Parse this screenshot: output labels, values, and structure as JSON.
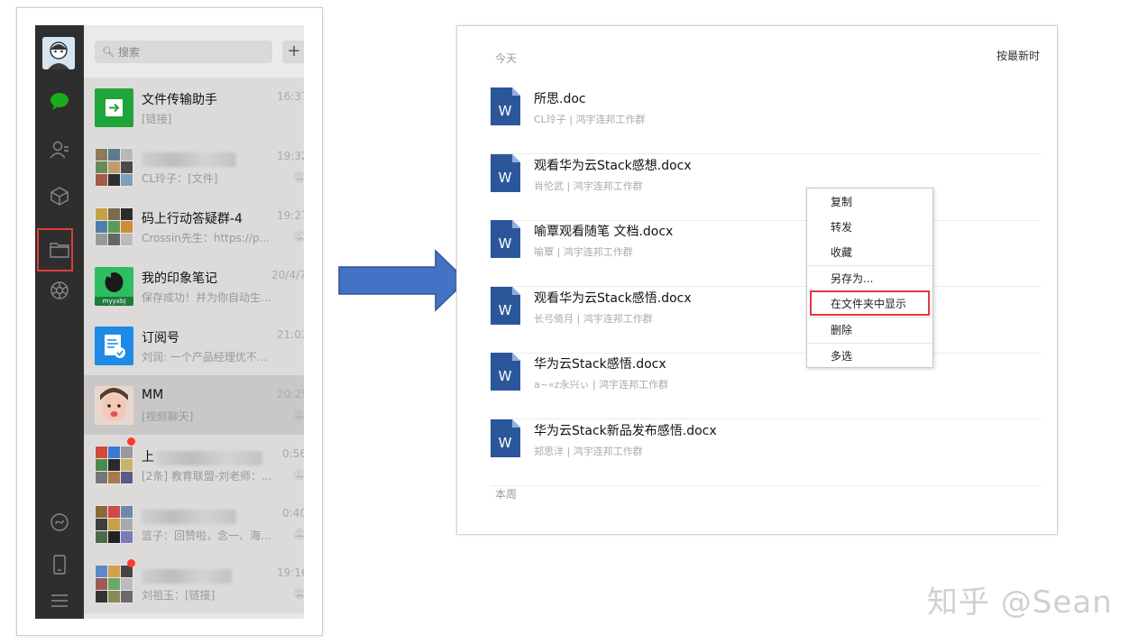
{
  "chat_window": {
    "search": {
      "placeholder": "搜索",
      "add_label": "+"
    },
    "sidebar_icons": [
      "avatar",
      "chat-icon",
      "contacts-icon",
      "favorites-icon",
      "folder-icon",
      "moments-icon",
      "mini-program-icon",
      "phone-icon",
      "menu-icon"
    ],
    "items": [
      {
        "name": "文件传输助手",
        "preview": "[链接]",
        "time": "16:37"
      },
      {
        "name": "",
        "preview": "CL玲子：[文件]",
        "time": "19:32"
      },
      {
        "name": "码上行动答疑群-4",
        "preview": "Crossin先生：https://p...",
        "time": "19:27"
      },
      {
        "name": "我的印象笔记",
        "preview": "保存成功！并为你自动生...",
        "time": "20/4/7"
      },
      {
        "name": "订阅号",
        "preview": "刘润: 一个产品经理优不...",
        "time": "21:03"
      },
      {
        "name": "MM",
        "preview": "[视频聊天]",
        "time": "20:25"
      },
      {
        "name": "上",
        "preview": "[2条] 教育联盟-刘老师：...",
        "time": "0:56"
      },
      {
        "name": "",
        "preview": "篮子：回赞啦，念一、海...",
        "time": "0:40"
      },
      {
        "name": "",
        "preview": "刘祖玉：[链接]",
        "time": "19:16"
      }
    ],
    "evernote_badge": "myyxbj"
  },
  "file_window": {
    "section_today": "今天",
    "section_week": "本周",
    "sort_label": "按最新时",
    "file_icon_letter": "W",
    "files": [
      {
        "name": "所思.doc",
        "meta": "CL玲子 | 鸿宇连邦工作群"
      },
      {
        "name": "观看华为云Stack感想.docx",
        "meta": "肖伦武 | 鸿宇连邦工作群"
      },
      {
        "name": "喻覃观看随笔 文档.docx",
        "meta": "喻覃 | 鸿宇连邦工作群"
      },
      {
        "name": "观看华为云Stack感悟.docx",
        "meta": "长弓倚月 | 鸿宇连邦工作群"
      },
      {
        "name": "华为云Stack感悟.docx",
        "meta": "a~«z永兴ぃ | 鸿宇连邦工作群"
      },
      {
        "name": "华为云Stack新品发布感悟.docx",
        "meta": "郑思洋 | 鸿宇连邦工作群"
      }
    ],
    "context_menu": [
      "复制",
      "转发",
      "收藏",
      "另存为...",
      "在文件夹中显示",
      "删除",
      "多选"
    ]
  },
  "watermark": "知乎 @Sean",
  "colors": {
    "highlight_red": "#e23b3b",
    "arrow_blue": "#4472c4",
    "word_blue": "#2b579a",
    "wechat_green": "#1aad19"
  }
}
